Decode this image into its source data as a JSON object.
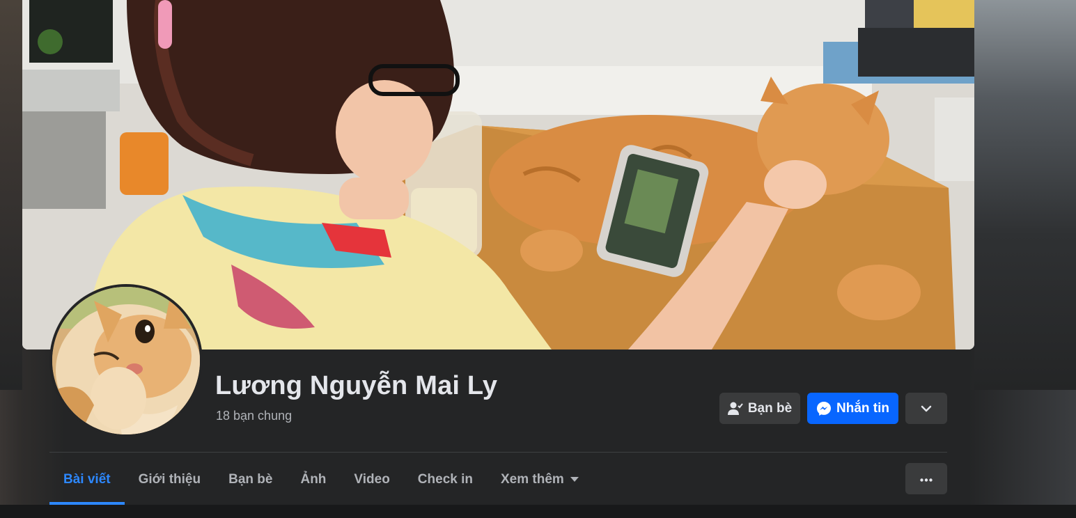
{
  "profile": {
    "name": "Lương Nguyễn Mai Ly",
    "mutual_friends": "18 bạn chung"
  },
  "actions": {
    "friends_label": "Bạn bè",
    "message_label": "Nhắn tin"
  },
  "tabs": [
    {
      "label": "Bài viết",
      "active": true
    },
    {
      "label": "Giới thiệu"
    },
    {
      "label": "Bạn bè"
    },
    {
      "label": "Ảnh"
    },
    {
      "label": "Video"
    },
    {
      "label": "Check in"
    },
    {
      "label": "Xem thêm",
      "icon": "caret-down-icon"
    }
  ],
  "colors": {
    "accent": "#2d88ff",
    "message_button": "#0866ff",
    "surface": "#242526",
    "secondary_button": "#3a3b3c"
  },
  "icons": [
    "person-check-icon",
    "messenger-icon",
    "chevron-down-icon",
    "more-horizontal-icon",
    "caret-down-icon"
  ]
}
